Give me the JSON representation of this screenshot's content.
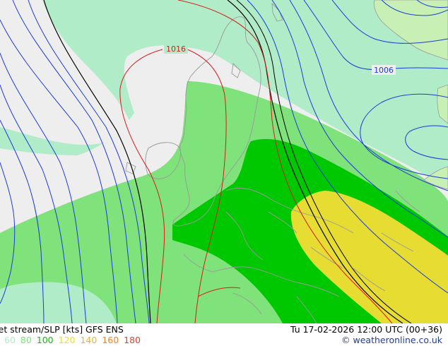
{
  "map": {
    "isobar_labels": [
      {
        "text": "1016",
        "color": "#d81b1b"
      },
      {
        "text": "1006",
        "color": "#1a3cdc"
      }
    ],
    "colors": {
      "background": "#eeeeee",
      "jet_60": "#b0ecc8",
      "jet_80": "#80e27a",
      "jet_100": "#00c800",
      "jet_120": "#e6dc32",
      "land": "#c8f0b4",
      "isobar_blue": "#1a3cdc",
      "isobar_red": "#d81b1b",
      "isobar_black": "#000000",
      "coastline": "#9a9a9a"
    }
  },
  "footer": {
    "title": "Jet stream/SLP [kts] GFS ENS",
    "valid": "Tu 17-02-2026 12:00 UTC (00+36)",
    "credit": "© weatheronline.co.uk",
    "scale": [
      {
        "label": "60",
        "color": "#b0ecc8"
      },
      {
        "label": "80",
        "color": "#80e27a"
      },
      {
        "label": "100",
        "color": "#00c800"
      },
      {
        "label": "120",
        "color": "#e6dc32"
      },
      {
        "label": "140",
        "color": "#f0b428"
      },
      {
        "label": "160",
        "color": "#f08228"
      },
      {
        "label": "180",
        "color": "#e63c28"
      }
    ]
  }
}
